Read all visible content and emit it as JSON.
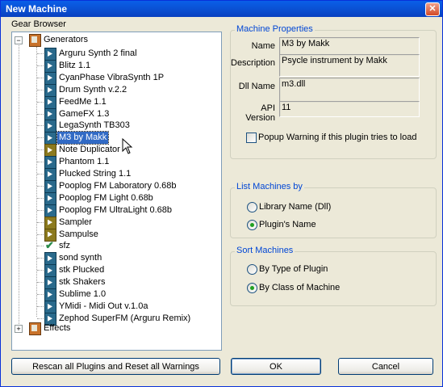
{
  "window": {
    "title": "New Machine",
    "close_glyph": "✕"
  },
  "gear_browser": {
    "label": "Gear Browser",
    "root_generators": {
      "label": "Generators",
      "expander": "−"
    },
    "generators": [
      {
        "label": "Arguru Synth 2 final",
        "icon": "plugin-icon"
      },
      {
        "label": "Blitz 1.1",
        "icon": "plugin-icon"
      },
      {
        "label": "CyanPhase VibraSynth 1P",
        "icon": "plugin-icon"
      },
      {
        "label": "Drum Synth v.2.2",
        "icon": "plugin-icon"
      },
      {
        "label": "FeedMe 1.1",
        "icon": "plugin-icon"
      },
      {
        "label": "GameFX 1.3",
        "icon": "plugin-icon"
      },
      {
        "label": "LegaSynth TB303",
        "icon": "plugin-icon"
      },
      {
        "label": "M3 by Makk",
        "icon": "plugin-icon",
        "selected": true
      },
      {
        "label": "Note Duplicator",
        "icon": "plugin-icon-yellow"
      },
      {
        "label": "Phantom 1.1",
        "icon": "plugin-icon"
      },
      {
        "label": "Plucked String 1.1",
        "icon": "plugin-icon"
      },
      {
        "label": "Pooplog FM Laboratory 0.68b",
        "icon": "plugin-icon"
      },
      {
        "label": "Pooplog FM Light 0.68b",
        "icon": "plugin-icon"
      },
      {
        "label": "Pooplog FM UltraLight 0.68b",
        "icon": "plugin-icon"
      },
      {
        "label": "Sampler",
        "icon": "plugin-icon-yellow"
      },
      {
        "label": "Sampulse",
        "icon": "plugin-icon-yellow"
      },
      {
        "label": "sfz",
        "icon": "check-icon"
      },
      {
        "label": "sond synth",
        "icon": "plugin-icon"
      },
      {
        "label": "stk Plucked",
        "icon": "plugin-icon"
      },
      {
        "label": "stk Shakers",
        "icon": "plugin-icon"
      },
      {
        "label": "Sublime 1.0",
        "icon": "plugin-icon"
      },
      {
        "label": "YMidi - Midi Out v.1.0a",
        "icon": "plugin-icon"
      },
      {
        "label": "Zephod SuperFM (Arguru Remix)",
        "icon": "plugin-icon"
      }
    ],
    "root_effects": {
      "label": "Effects",
      "expander": "+"
    }
  },
  "machine_properties": {
    "title": "Machine Properties",
    "name_label": "Name",
    "name_value": "M3 by Makk",
    "description_label": "Description",
    "description_value": "Psycle instrument by Makk",
    "dll_label": "Dll Name",
    "dll_value": "m3.dll",
    "api_label": "API Version",
    "api_value": "11",
    "popup_warning_label": "Popup Warning if this plugin tries to load",
    "popup_warning_checked": false
  },
  "list_machines_by": {
    "title": "List Machines by",
    "options": [
      {
        "label": "Library Name (Dll)",
        "selected": false
      },
      {
        "label": "Plugin's Name",
        "selected": true
      }
    ]
  },
  "sort_machines": {
    "title": "Sort Machines",
    "options": [
      {
        "label": "By Type of Plugin",
        "selected": false
      },
      {
        "label": "By Class of Machine",
        "selected": true
      }
    ]
  },
  "buttons": {
    "rescan": "Rescan all Plugins and Reset all Warnings",
    "ok": "OK",
    "cancel": "Cancel"
  }
}
